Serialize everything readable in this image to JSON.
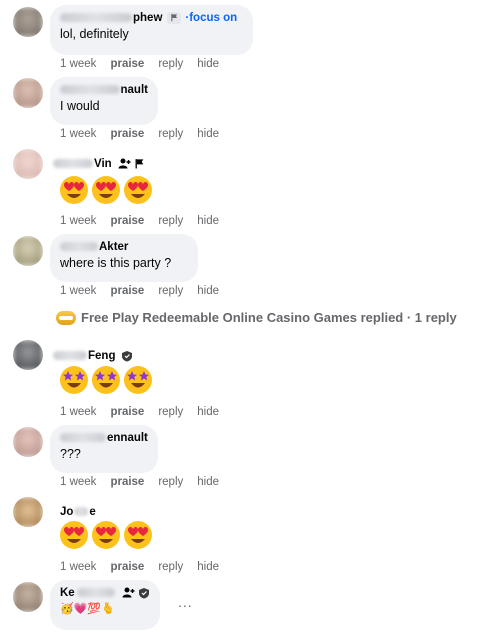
{
  "comments": [
    {
      "name_suffix": "phew",
      "focus_label": "·focus on",
      "text": "lol, definitely",
      "actions": [
        "1 week",
        "praise",
        "reply",
        "hide"
      ]
    },
    {
      "name_suffix": "nault",
      "text": "I would",
      "actions": [
        "1 week",
        "praise",
        "reply",
        "hide"
      ]
    },
    {
      "name_suffix": "Vin",
      "emoji": "heart-eyes",
      "actions": [
        "1 week",
        "praise",
        "reply",
        "hide"
      ]
    },
    {
      "name_suffix": "Akter",
      "text": "where is this party ?",
      "actions": [
        "1 week",
        "praise",
        "reply",
        "hide"
      ]
    },
    {
      "name_suffix": "Feng",
      "emoji": "star-struck",
      "actions": [
        "1 week",
        "praise",
        "reply",
        "hide"
      ]
    },
    {
      "name_suffix": "ennault",
      "text": "???",
      "actions": [
        "1 week",
        "praise",
        "reply",
        "hide"
      ]
    },
    {
      "name_prefix": "Jo",
      "name_suffix": "e",
      "emoji": "heart-eyes",
      "actions": [
        "1 week",
        "praise",
        "reply",
        "hide"
      ]
    },
    {
      "name_prefix": "Ke",
      "text": "🥳💗💯🫰"
    }
  ],
  "replies_summary": "Free Play Redeemable Online Casino Games replied · 1 reply",
  "more_label": "...",
  "icons": {
    "flag": "flag-icon",
    "add_friend": "add-friend-icon",
    "shield": "shield-icon"
  }
}
